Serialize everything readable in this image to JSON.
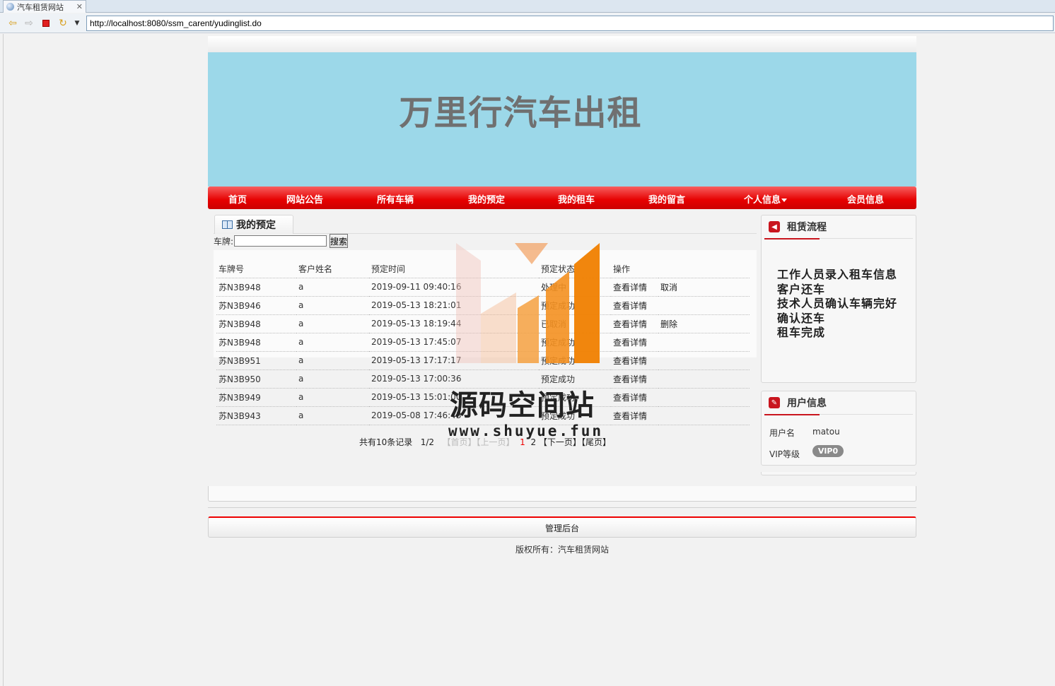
{
  "browser": {
    "tab_title": "汽车租赁网站",
    "url": "http://localhost:8080/ssm_carent/yudinglist.do"
  },
  "site": {
    "title": "万里行汽车出租",
    "nav": [
      "首页",
      "网站公告",
      "所有车辆",
      "我的预定",
      "我的租车",
      "我的留言",
      "个人信息",
      "会员信息"
    ]
  },
  "main": {
    "tab_label": "我的预定",
    "search_label": "车牌:",
    "search_value": "",
    "search_button": "搜索",
    "columns": [
      "车牌号",
      "客户姓名",
      "预定时间",
      "预定状态",
      "操作"
    ],
    "rows": [
      {
        "plate": "苏N3B948",
        "name": "a",
        "time": "2019-09-11 09:40:16",
        "status": "处理中",
        "view": "查看详情",
        "action": "取消"
      },
      {
        "plate": "苏N3B946",
        "name": "a",
        "time": "2019-05-13 18:21:01",
        "status": "预定成功",
        "view": "查看详情",
        "action": ""
      },
      {
        "plate": "苏N3B948",
        "name": "a",
        "time": "2019-05-13 18:19:44",
        "status": "已取消",
        "view": "查看详情",
        "action": "删除"
      },
      {
        "plate": "苏N3B948",
        "name": "a",
        "time": "2019-05-13 17:45:07",
        "status": "预定成功",
        "view": "查看详情",
        "action": ""
      },
      {
        "plate": "苏N3B951",
        "name": "a",
        "time": "2019-05-13 17:17:17",
        "status": "预定成功",
        "view": "查看详情",
        "action": ""
      },
      {
        "plate": "苏N3B950",
        "name": "a",
        "time": "2019-05-13 17:00:36",
        "status": "预定成功",
        "view": "查看详情",
        "action": ""
      },
      {
        "plate": "苏N3B949",
        "name": "a",
        "time": "2019-05-13 15:01:00",
        "status": "预定成功",
        "view": "查看详情",
        "action": ""
      },
      {
        "plate": "苏N3B943",
        "name": "a",
        "time": "2019-05-08 17:46:43",
        "status": "预定成功",
        "view": "查看详情",
        "action": ""
      }
    ],
    "pager": {
      "summary": "共有10条记录",
      "page": "1/2",
      "first": "【首页】",
      "prev": "【上一页】",
      "current": "1",
      "next_page": "2",
      "next": "【下一页】",
      "last": "【尾页】"
    }
  },
  "sidebar": {
    "flow_title": "租赁流程",
    "flow_steps": [
      "工作人员录入租车信息",
      "客户还车",
      "技术人员确认车辆完好",
      "确认还车",
      "租车完成"
    ],
    "user_title": "用户信息",
    "username_label": "用户名",
    "username": "matou",
    "vip_label": "VIP等级",
    "vip": "VIP0"
  },
  "footer": {
    "admin": "管理后台",
    "copyright": "版权所有：汽车租赁网站"
  },
  "watermark": {
    "text": "源码空间站",
    "url": "www.shuyue.fun"
  }
}
